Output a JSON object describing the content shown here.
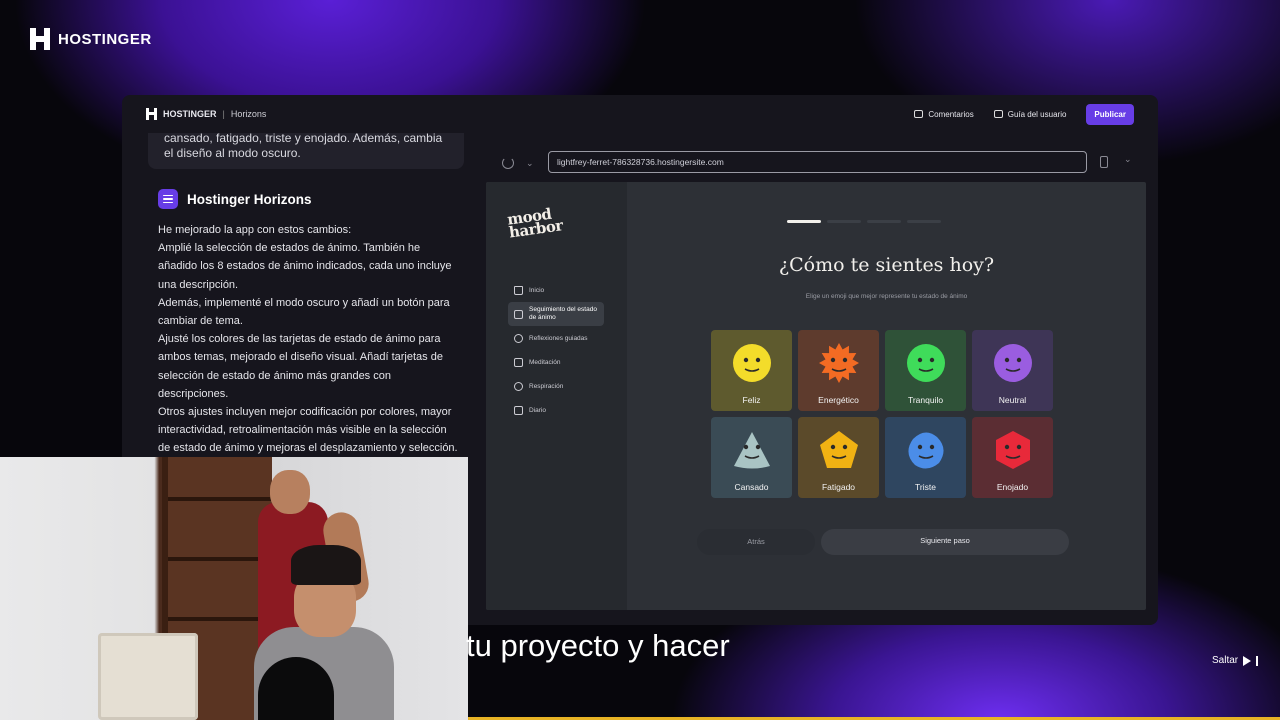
{
  "brand": {
    "name": "HOSTINGER"
  },
  "topbar": {
    "brand": "HOSTINGER",
    "separator": "|",
    "product": "Horizons",
    "comments_label": "Comentarios",
    "guide_label": "Guía del usuario",
    "publish_label": "Publicar"
  },
  "chat": {
    "user_bubble": "cansado, fatigado, triste y enojado. Además, cambia el diseño al modo oscuro.",
    "assistant_name": "Hostinger Horizons",
    "reply_lines": [
      "He mejorado la app con estos cambios:",
      "Amplié la selección de estados de ánimo. También he añadido los 8 estados de ánimo indicados, cada uno incluye una descripción.",
      "Además, implementé el modo oscuro y añadí un botón para cambiar de tema.",
      "Ajusté los colores de las tarjetas de estado de ánimo para ambos temas, mejorado el diseño visual. Añadí tarjetas de selección de estado de ánimo más grandes con descripciones.",
      "Otros ajustes incluyen mejor codificación por colores, mayor interactividad, retroalimentación más visible en la selección de estado de ánimo y mejoras el desplazamiento y selección."
    ]
  },
  "preview": {
    "url": "lightfrey-ferret-786328736.hostingersite.com",
    "logo_line1": "mood",
    "logo_line2": "harbor",
    "nav": [
      {
        "label": "Inicio",
        "icon": "home-icon"
      },
      {
        "label": "Seguimiento del estado de ánimo",
        "icon": "scan-face-icon",
        "active": true
      },
      {
        "label": "Reflexiones guiadas",
        "icon": "sparkle-icon"
      },
      {
        "label": "Meditación",
        "icon": "scale-icon"
      },
      {
        "label": "Respiración",
        "icon": "wind-icon"
      },
      {
        "label": "Diario",
        "icon": "journal-icon"
      }
    ],
    "progress": {
      "current_step": 1,
      "total_steps": 4
    },
    "heading": "¿Cómo te sientes hoy?",
    "subheading": "Elige un emoji que mejor represente tu estado de ánimo",
    "moods": [
      {
        "label": "Feliz",
        "bg": "#5e5a2e",
        "color": "#f3dc2a",
        "shape": "circle"
      },
      {
        "label": "Energético",
        "bg": "#5e3b2d",
        "color": "#f36b23",
        "shape": "star"
      },
      {
        "label": "Tranquilo",
        "bg": "#2f5238",
        "color": "#3fdc5a",
        "shape": "circle"
      },
      {
        "label": "Neutral",
        "bg": "#3e3556",
        "color": "#9a5de0",
        "shape": "circle"
      },
      {
        "label": "Cansado",
        "bg": "#3a4b55",
        "color": "#a9c4c4",
        "shape": "triangle"
      },
      {
        "label": "Fatigado",
        "bg": "#5b4a2a",
        "color": "#f1b213",
        "shape": "pentagon"
      },
      {
        "label": "Triste",
        "bg": "#2f4660",
        "color": "#4b8de8",
        "shape": "blob"
      },
      {
        "label": "Enojado",
        "bg": "#5b2d33",
        "color": "#e8293a",
        "shape": "hexagon"
      }
    ],
    "back_label": "Atrás",
    "next_label": "Siguiente paso"
  },
  "overlay": {
    "subtitle": "tu proyecto y hacer",
    "skip_label": "Saltar"
  }
}
